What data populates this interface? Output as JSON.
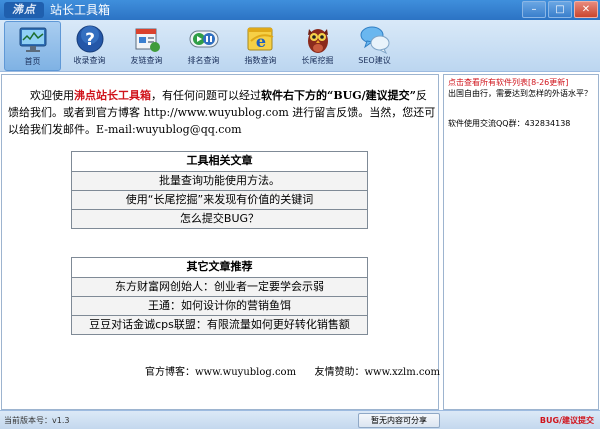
{
  "window": {
    "logo_text": "沸点",
    "title": "站长工具箱",
    "min_label": "–",
    "max_label": "□",
    "close_label": "✕"
  },
  "toolbar": {
    "items": [
      {
        "label": "首页",
        "icon": "monitor-icon"
      },
      {
        "label": "收录查询",
        "icon": "help-icon"
      },
      {
        "label": "友链查询",
        "icon": "links-icon"
      },
      {
        "label": "排名查询",
        "icon": "ranking-icon"
      },
      {
        "label": "指数查询",
        "icon": "browser-icon"
      },
      {
        "label": "长尾挖掘",
        "icon": "owl-icon"
      },
      {
        "label": "SEO建议",
        "icon": "chat-icon"
      }
    ]
  },
  "intro": {
    "p1": "欢迎使用",
    "brand": "沸点站长工具箱",
    "p2": "，有任何问题可以经过",
    "bold1": "软件右下方的“BUG/建议提交”",
    "p3": "反馈给我们。或者到官方博客 http://www.wuyublog.com 进行留言反馈。当然，您还可以给我们发邮件。E-mail:wuyublog@qq.com"
  },
  "tools_box": {
    "title": "工具相关文章",
    "items": [
      "批量查询功能使用方法。",
      "使用“长尾挖掘”来发现有价值的关键词",
      "怎么提交BUG？"
    ]
  },
  "other_box": {
    "title": "其它文章推荐",
    "items": [
      "东方财富网创始人：创业者一定要学会示弱",
      "王通：如何设计你的营销鱼饵",
      "豆豆对话金诚cps联盟：有限流量如何更好转化销售额"
    ]
  },
  "footer": {
    "blog": "官方博客：www.wuyublog.com",
    "sponsor": "友情赞助：www.xzlm.com"
  },
  "sidebar": {
    "link": "点击查看所有软件列表[8-26更新]",
    "question": "出国自由行，需要达到怎样的外语水平？",
    "qq": "软件使用交流QQ群：432834138"
  },
  "status": {
    "version": "当前版本号：v1.3",
    "share": "暂无内容可分享",
    "bug": "BUG/建议提交"
  },
  "colors": {
    "accent_red": "#d0141c",
    "titlebar": "#2c73c4"
  }
}
